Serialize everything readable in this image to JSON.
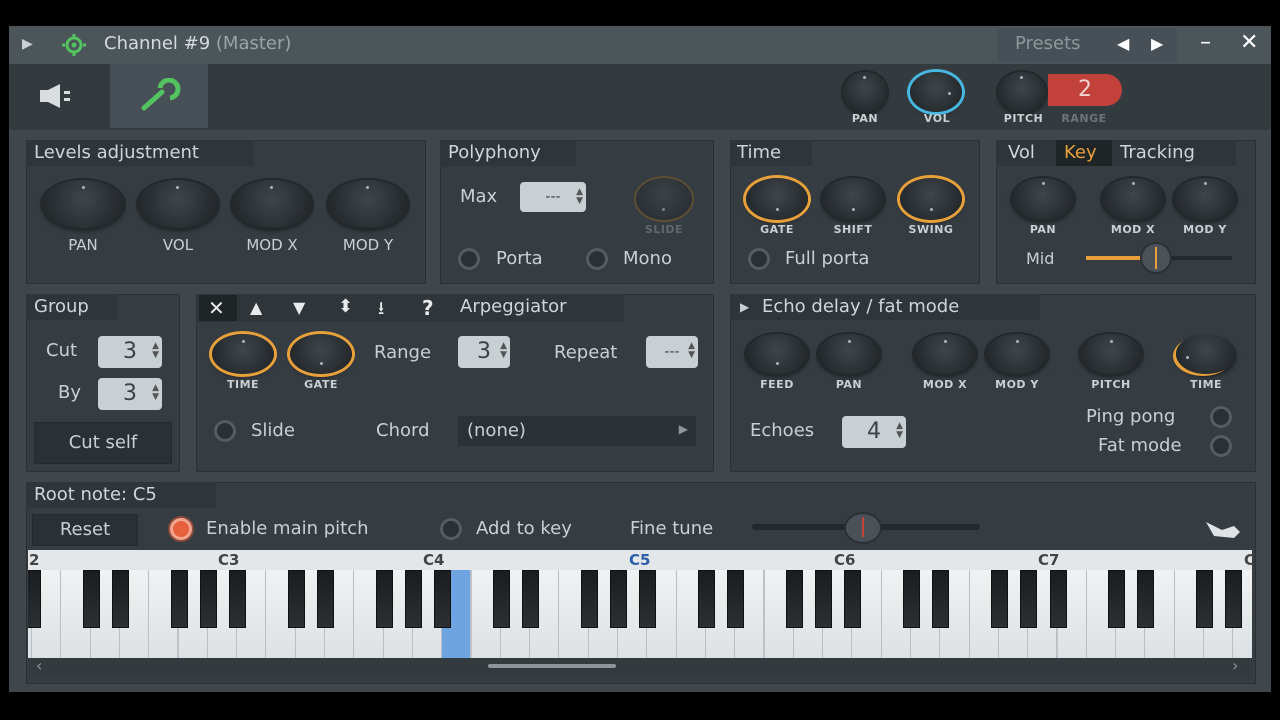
{
  "window": {
    "title": "Channel #9",
    "subtitle": "(Master)",
    "presets_label": "Presets"
  },
  "topbar": {
    "pan_label": "PAN",
    "vol_label": "VOL",
    "pitch_label": "PITCH",
    "range_value": "2",
    "range_label": "RANGE"
  },
  "levels": {
    "title": "Levels adjustment",
    "knobs": [
      "PAN",
      "VOL",
      "MOD X",
      "MOD Y"
    ]
  },
  "polyphony": {
    "title": "Polyphony",
    "max_label": "Max",
    "max_value": "---",
    "slide_label": "SLIDE",
    "porta_label": "Porta",
    "mono_label": "Mono"
  },
  "time": {
    "title": "Time",
    "knobs": [
      "GATE",
      "SHIFT",
      "SWING"
    ],
    "full_porta_label": "Full porta"
  },
  "tracking": {
    "tabs": [
      "Vol",
      "Key",
      "Tracking"
    ],
    "knobs": [
      "PAN",
      "MOD X",
      "MOD Y"
    ],
    "mid_label": "Mid"
  },
  "group": {
    "title": "Group",
    "cut_label": "Cut",
    "cut_value": "3",
    "by_label": "By",
    "by_value": "3",
    "cut_self_label": "Cut self"
  },
  "arpeggiator": {
    "title": "Arpeggiator",
    "tool_icons": [
      "✕",
      "▲",
      "▼",
      "⬍",
      "⭳",
      "?"
    ],
    "knobs": [
      "TIME",
      "GATE"
    ],
    "range_label": "Range",
    "range_value": "3",
    "repeat_label": "Repeat",
    "repeat_value": "---",
    "slide_label": "Slide",
    "chord_label": "Chord",
    "chord_value": "(none)"
  },
  "echo": {
    "title": "Echo delay / fat mode",
    "knobs": [
      "FEED",
      "PAN",
      "MOD X",
      "MOD Y",
      "PITCH",
      "TIME"
    ],
    "echoes_label": "Echoes",
    "echoes_value": "4",
    "ping_pong_label": "Ping pong",
    "fat_mode_label": "Fat mode"
  },
  "root": {
    "title": "Root note: C5",
    "reset_label": "Reset",
    "enable_main_pitch_label": "Enable main pitch",
    "add_to_key_label": "Add to key",
    "fine_tune_label": "Fine tune"
  },
  "keyboard": {
    "octaves": [
      "2",
      "C3",
      "C4",
      "C5",
      "C6",
      "C7",
      "C"
    ],
    "highlight_note": "C5"
  },
  "colors": {
    "accent_orange": "#e8a13a",
    "accent_cyan": "#48b7e0",
    "highlight_key": "#6fa4e3",
    "range_red": "#c2413b"
  }
}
